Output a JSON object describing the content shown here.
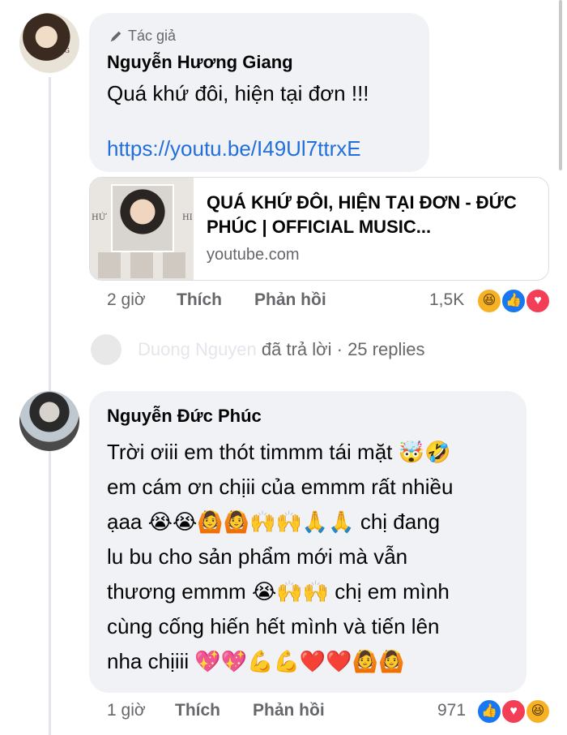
{
  "comment1": {
    "author_badge": "Tác giả",
    "author": "Nguyễn Hương Giang",
    "avatar_text": "EM ĐƯƠNG",
    "text": "Quá khứ đôi, hiện tại đơn !!!",
    "link": "https://youtu.be/I49Ul7ttrxE",
    "preview": {
      "thumb_left": "HỨ",
      "thumb_right": "HI",
      "title": "QUÁ KHỨ ĐÔI, HIỆN TẠI ĐƠN - ĐỨC PHÚC | OFFICIAL MUSIC...",
      "domain": "youtube.com"
    },
    "time": "2 giờ",
    "like_label": "Thích",
    "reply_label": "Phản hồi",
    "reaction_count": "1,5K",
    "reactions": [
      "haha-icon",
      "like-icon",
      "love-icon"
    ]
  },
  "replies_row": {
    "replier": "Duong Nguyen",
    "verb": "đã trả lời",
    "separator": "·",
    "count_label": "25 replies"
  },
  "comment2": {
    "author": "Nguyễn Đức Phúc",
    "lines": [
      "Trời ơiii em thót timmm tái mặt 🤯🤣",
      "em cám ơn chịii của emmm rất nhiều",
      "ạaa 😭😭🙆🙆🙌🙌🙏🙏 chị đang",
      "lu bu cho sản phẩm mới mà vẫn",
      "thương emmm 😭🙌🙌 chị em mình",
      "cùng cống hiến hết mình và tiến lên",
      "nha chịiii 💖💖💪💪❤️❤️🙆🙆"
    ],
    "time": "1 giờ",
    "like_label": "Thích",
    "reply_label": "Phản hồi",
    "reaction_count": "971",
    "reactions": [
      "like-icon",
      "love-icon",
      "haha-icon"
    ]
  },
  "colors": {
    "bubble": "#f0f2f5",
    "link": "#216fdb",
    "muted": "#65676b",
    "like": "#1877f2",
    "love": "#f33e58",
    "haha": "#f7b125"
  }
}
